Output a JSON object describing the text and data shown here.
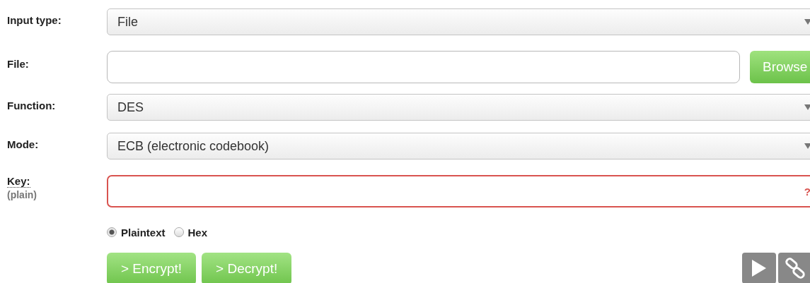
{
  "fields": [
    {
      "kind": "select",
      "label": "Input type:",
      "value": "File"
    },
    {
      "kind": "file",
      "label": "File:",
      "button": "Browse"
    },
    {
      "kind": "select",
      "label": "Function:",
      "value": "DES"
    },
    {
      "kind": "select",
      "label": "Mode:",
      "value": "ECB (electronic codebook)"
    },
    {
      "kind": "key",
      "label": "Key:",
      "sublabel": "(plain)",
      "hint": "?",
      "invalid": true
    }
  ],
  "key_format": [
    {
      "label": "Plaintext",
      "selected": true
    },
    {
      "label": "Hex",
      "selected": false
    }
  ],
  "actions": [
    "> Encrypt!",
    "> Decrypt!"
  ]
}
